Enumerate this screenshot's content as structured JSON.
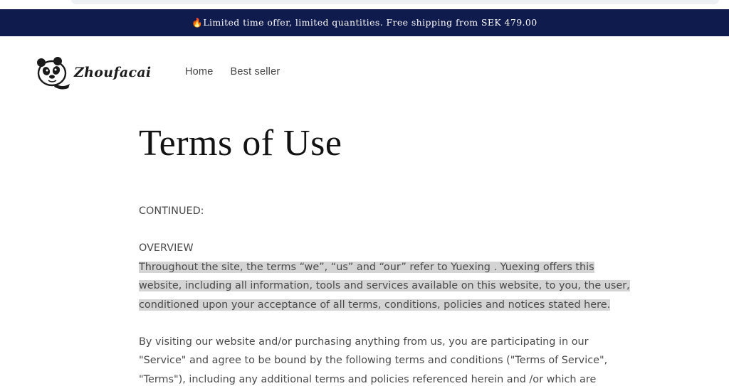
{
  "announcement": {
    "icon": "fire-icon",
    "text": "Limited time offer, limited quantities. Free shipping from SEK 479.00"
  },
  "brand": {
    "name": "Zhoufacai",
    "logo_icon": "panda-icon"
  },
  "nav": {
    "items": [
      {
        "label": "Home"
      },
      {
        "label": "Best seller"
      }
    ]
  },
  "page": {
    "title": "Terms of Use",
    "continued_label": "CONTINUED:",
    "overview_heading": "OVERVIEW",
    "overview_lines": [
      "Throughout the site, the terms “we”, “us” and “our” refer to Yuexing .  Yuexing  offers this",
      "website, including all information, tools and services available on this website, to you, the user,",
      "conditioned upon your acceptance of all terms, conditions, policies and notices stated here."
    ],
    "service_lines": [
      "By visiting our website and/or purchasing anything from us, you are participating in our",
      "\"Service\" and agree to be bound by the following terms and conditions (\"Terms of Service\",",
      "\"Terms\"), including any additional terms and policies referenced herein and /or which are"
    ]
  },
  "colors": {
    "announcement_bg": "#0f1a4d",
    "highlight": "#d4d4d4"
  }
}
